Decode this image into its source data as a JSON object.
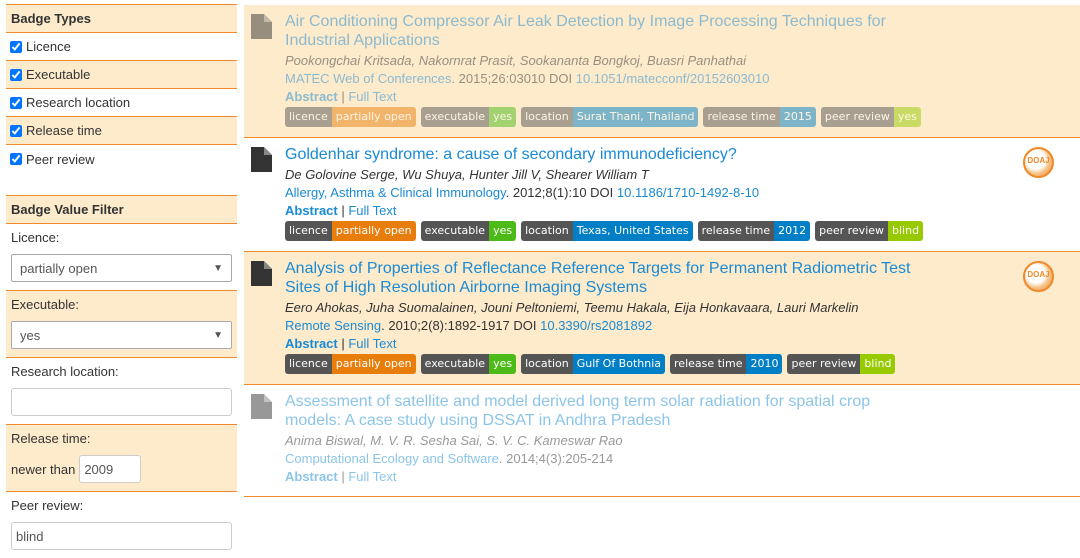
{
  "sidebar": {
    "badge_types_title": "Badge Types",
    "badge_types": [
      "Licence",
      "Executable",
      "Research location",
      "Release time",
      "Peer review"
    ],
    "filter_title": "Badge Value Filter",
    "licence_label": "Licence:",
    "licence_value": "partially open",
    "executable_label": "Executable:",
    "executable_value": "yes",
    "location_label": "Research location:",
    "location_value": "",
    "release_label": "Release time:",
    "newer_than": "newer than",
    "release_value": "2009",
    "peer_label": "Peer review:",
    "peer_value": "blind"
  },
  "colors": {
    "accent": "#f0892a",
    "licence": "#e87d0c",
    "yes": "#4cbb17",
    "blue": "#007ec6",
    "blind": "#97ca00"
  },
  "results": [
    {
      "title": "Air Conditioning Compressor Air Leak Detection by Image Processing Techniques for Industrial Applications",
      "authors": "Pookongchai Kritsada, Nakornrat Prasit, Sookananta Bongkoj, Buasri Panhathai",
      "journal": "MATEC Web of Conferences",
      "citation": ". 2015;26:03010 DOI ",
      "doi": "10.1051/matecconf/20152603010",
      "abstract": "Abstract",
      "fulltext": "Full Text",
      "faded": true,
      "alt": true,
      "seal": false,
      "badges": [
        [
          "licence",
          "partially open",
          "licence"
        ],
        [
          "executable",
          "yes",
          "yes"
        ],
        [
          "location",
          "Surat Thani, Thailand",
          "blue"
        ],
        [
          "release time",
          "2015",
          "blue"
        ],
        [
          "peer review",
          "yes",
          "blind"
        ]
      ]
    },
    {
      "title": "Goldenhar syndrome: a cause of secondary immunodeficiency?",
      "authors": "De Golovine Serge, Wu Shuya, Hunter Jill V, Shearer William T",
      "journal": "Allergy, Asthma & Clinical Immunology",
      "citation": ". 2012;8(1):10 DOI ",
      "doi": "10.1186/1710-1492-8-10",
      "abstract": "Abstract",
      "fulltext": "Full Text",
      "faded": false,
      "alt": false,
      "seal": true,
      "seal_text": "DOAJ",
      "badges": [
        [
          "licence",
          "partially open",
          "licence"
        ],
        [
          "executable",
          "yes",
          "yes"
        ],
        [
          "location",
          "Texas, United States",
          "blue"
        ],
        [
          "release time",
          "2012",
          "blue"
        ],
        [
          "peer review",
          "blind",
          "blind"
        ]
      ]
    },
    {
      "title": "Analysis of Properties of Reflectance Reference Targets for Permanent Radiometric Test Sites of High Resolution Airborne Imaging Systems",
      "authors": "Eero Ahokas, Juha Suomalainen, Jouni Peltoniemi, Teemu Hakala, Eija Honkavaara, Lauri Markelin",
      "journal": "Remote Sensing",
      "citation": ". 2010;2(8):1892-1917 DOI ",
      "doi": "10.3390/rs2081892",
      "abstract": "Abstract",
      "fulltext": "Full Text",
      "faded": false,
      "alt": true,
      "seal": true,
      "seal_text": "DOAJ",
      "badges": [
        [
          "licence",
          "partially open",
          "licence"
        ],
        [
          "executable",
          "yes",
          "yes"
        ],
        [
          "location",
          "Gulf Of Bothnia",
          "blue"
        ],
        [
          "release time",
          "2010",
          "blue"
        ],
        [
          "peer review",
          "blind",
          "blind"
        ]
      ]
    },
    {
      "title": "Assessment of satellite and model derived long term solar radiation for spatial crop models: A case study using DSSAT in Andhra Pradesh",
      "authors": "Anima Biswal, M. V. R. Sesha Sai, S. V. C. Kameswar Rao",
      "journal": "Computational Ecology and Software",
      "citation": ". 2014;4(3):205-214",
      "doi": "",
      "abstract": "Abstract",
      "fulltext": "Full Text",
      "faded": true,
      "alt": false,
      "seal": false,
      "badges": []
    }
  ]
}
